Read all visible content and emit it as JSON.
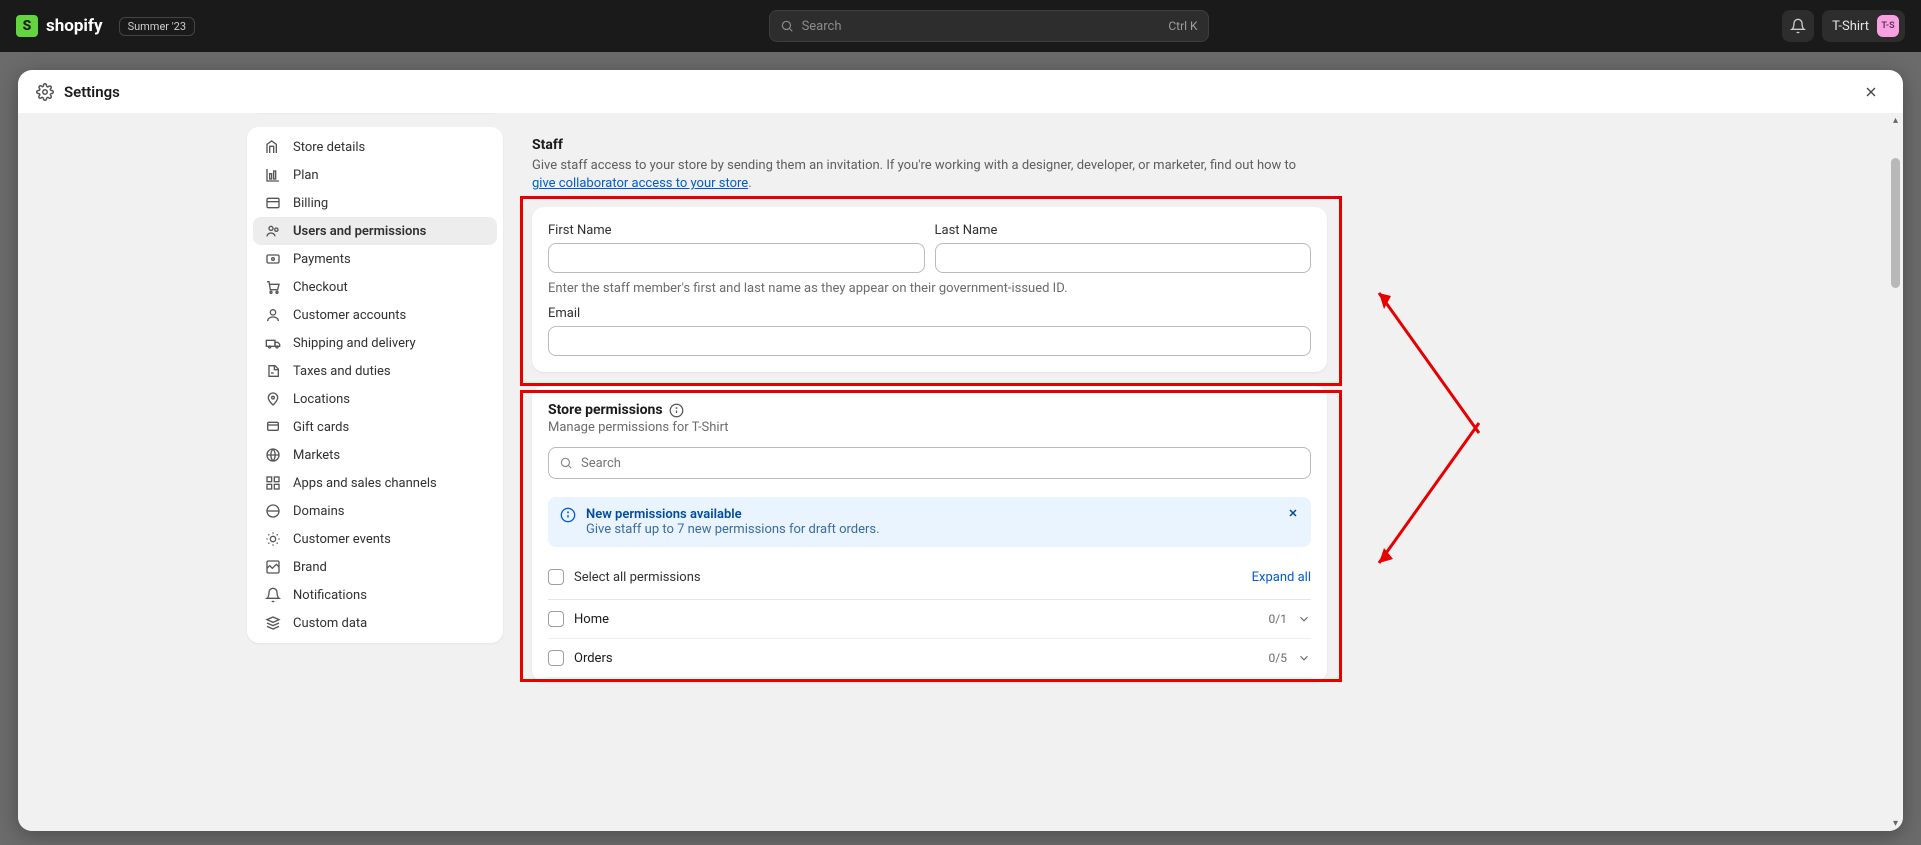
{
  "topbar": {
    "wordmark": "shopify",
    "badge": "Summer '23",
    "search_placeholder": "Search",
    "kbd": "Ctrl K",
    "store_name": "T-Shirt",
    "avatar_initials": "T-S"
  },
  "modal": {
    "title": "Settings"
  },
  "sidebar": {
    "items": [
      {
        "label": "Store details"
      },
      {
        "label": "Plan"
      },
      {
        "label": "Billing"
      },
      {
        "label": "Users and permissions"
      },
      {
        "label": "Payments"
      },
      {
        "label": "Checkout"
      },
      {
        "label": "Customer accounts"
      },
      {
        "label": "Shipping and delivery"
      },
      {
        "label": "Taxes and duties"
      },
      {
        "label": "Locations"
      },
      {
        "label": "Gift cards"
      },
      {
        "label": "Markets"
      },
      {
        "label": "Apps and sales channels"
      },
      {
        "label": "Domains"
      },
      {
        "label": "Customer events"
      },
      {
        "label": "Brand"
      },
      {
        "label": "Notifications"
      },
      {
        "label": "Custom data"
      }
    ],
    "active_index": 3
  },
  "staff": {
    "heading": "Staff",
    "description_prefix": "Give staff access to your store by sending them an invitation. If you're working with a designer, developer, or marketer, find out how to ",
    "link_text": "give collaborator access to your store",
    "description_suffix": ".",
    "first_name_label": "First Name",
    "last_name_label": "Last Name",
    "name_help": "Enter the staff member's first and last name as they appear on their government-issued ID.",
    "email_label": "Email",
    "first_name_value": "",
    "last_name_value": "",
    "email_value": ""
  },
  "permissions": {
    "heading": "Store permissions",
    "subheading": "Manage permissions for T-Shirt",
    "search_placeholder": "Search",
    "banner": {
      "title": "New permissions available",
      "body": "Give staff up to 7 new permissions for draft orders."
    },
    "select_all_label": "Select all permissions",
    "expand_all_label": "Expand all",
    "rows": [
      {
        "label": "Home",
        "count": "0/1"
      },
      {
        "label": "Orders",
        "count": "0/5"
      }
    ]
  }
}
